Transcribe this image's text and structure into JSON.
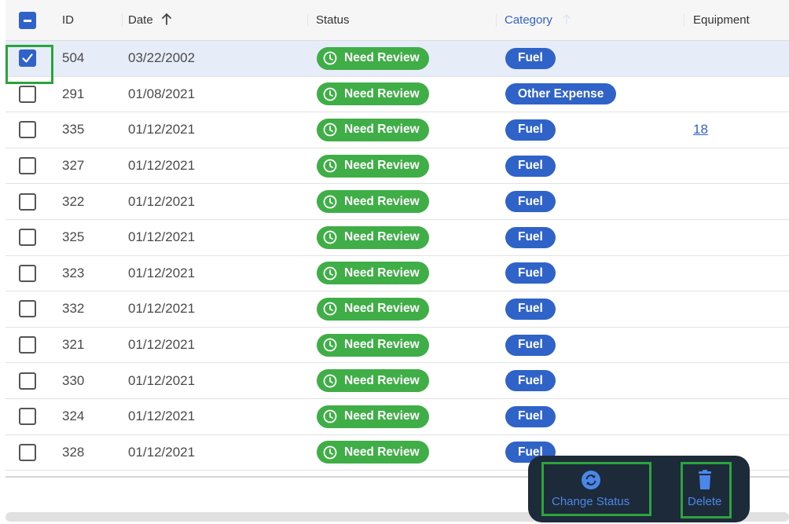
{
  "table": {
    "columns": {
      "id": "ID",
      "date": "Date",
      "status": "Status",
      "category": "Category",
      "equipment": "Equipment"
    },
    "rows": [
      {
        "id": "504",
        "date": "03/22/2002",
        "status": "Need Review",
        "category": "Fuel",
        "equipment": "",
        "selected": true
      },
      {
        "id": "291",
        "date": "01/08/2021",
        "status": "Need Review",
        "category": "Other Expense",
        "equipment": "",
        "selected": false
      },
      {
        "id": "335",
        "date": "01/12/2021",
        "status": "Need Review",
        "category": "Fuel",
        "equipment": "18",
        "selected": false
      },
      {
        "id": "327",
        "date": "01/12/2021",
        "status": "Need Review",
        "category": "Fuel",
        "equipment": "",
        "selected": false
      },
      {
        "id": "322",
        "date": "01/12/2021",
        "status": "Need Review",
        "category": "Fuel",
        "equipment": "",
        "selected": false
      },
      {
        "id": "325",
        "date": "01/12/2021",
        "status": "Need Review",
        "category": "Fuel",
        "equipment": "",
        "selected": false
      },
      {
        "id": "323",
        "date": "01/12/2021",
        "status": "Need Review",
        "category": "Fuel",
        "equipment": "",
        "selected": false
      },
      {
        "id": "332",
        "date": "01/12/2021",
        "status": "Need Review",
        "category": "Fuel",
        "equipment": "",
        "selected": false
      },
      {
        "id": "321",
        "date": "01/12/2021",
        "status": "Need Review",
        "category": "Fuel",
        "equipment": "",
        "selected": false
      },
      {
        "id": "330",
        "date": "01/12/2021",
        "status": "Need Review",
        "category": "Fuel",
        "equipment": "",
        "selected": false
      },
      {
        "id": "324",
        "date": "01/12/2021",
        "status": "Need Review",
        "category": "Fuel",
        "equipment": "",
        "selected": false
      },
      {
        "id": "328",
        "date": "01/12/2021",
        "status": "Need Review",
        "category": "Fuel",
        "equipment": "",
        "selected": false
      }
    ]
  },
  "actions": {
    "change_status": "Change Status",
    "delete": "Delete"
  },
  "icons": {
    "select_all": "minus-checkbox-icon",
    "date_sort": "arrow-up-icon",
    "category_sort": "arrow-up-icon",
    "status_badge": "clock-icon",
    "change_status": "refresh-circle-icon",
    "delete": "trash-icon"
  },
  "colors": {
    "accent_blue": "#2f63c8",
    "status_green": "#3fae46",
    "action_bar_bg": "#1d2a3a",
    "action_text": "#4a87e8",
    "highlight_green": "#2ca43c",
    "selected_row_bg": "#e7edf8"
  }
}
